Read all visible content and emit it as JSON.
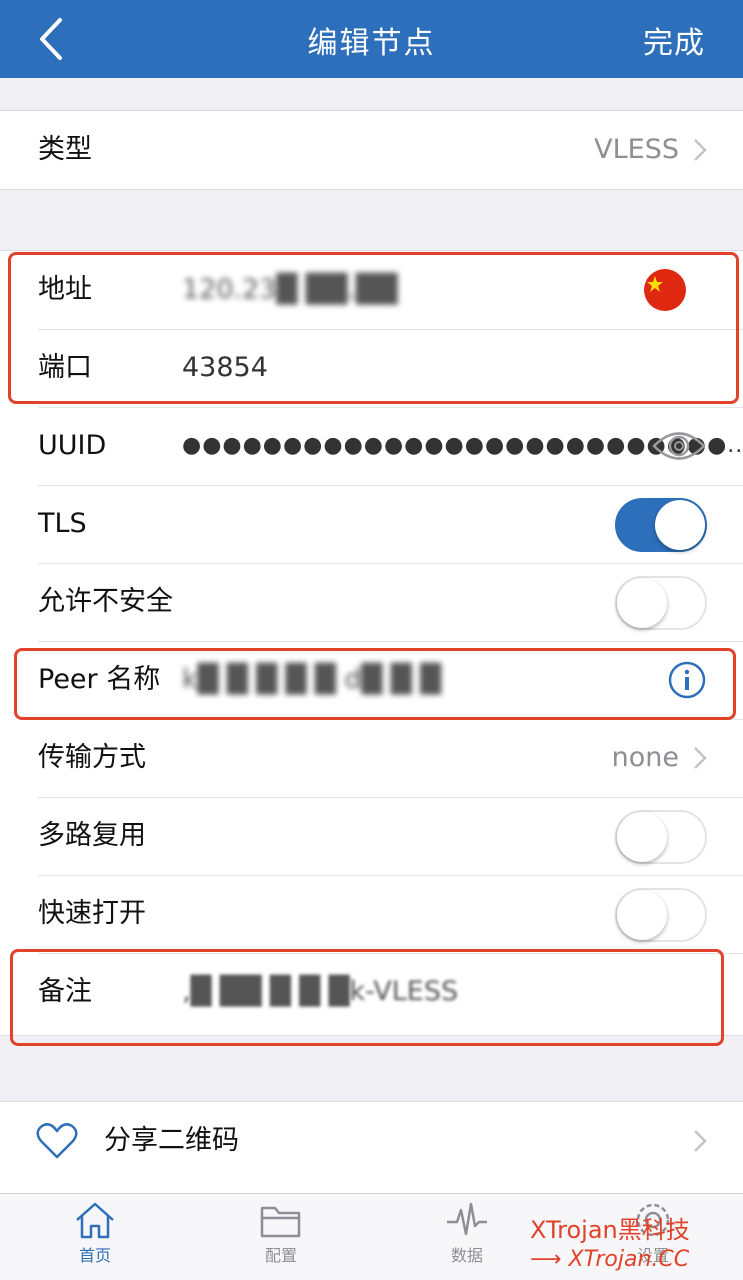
{
  "nav": {
    "title": "编辑节点",
    "done_label": "完成"
  },
  "type_row": {
    "label": "类型",
    "value": "VLESS"
  },
  "address_row": {
    "label": "地址",
    "value": "120.23█ ██.██"
  },
  "port_row": {
    "label": "端口",
    "value": "43854"
  },
  "uuid_row": {
    "label": "UUID",
    "value": "●●●●●●●●●●●●●●●●●●●●●●●●●●●..."
  },
  "tls_row": {
    "label": "TLS",
    "on": true
  },
  "insecure_row": {
    "label": "允许不安全",
    "on": false
  },
  "peer_row": {
    "label": "Peer 名称",
    "value": "k█ █ █ █ █ d█ █ █"
  },
  "transport_row": {
    "label": "传输方式",
    "value": "none"
  },
  "mux_row": {
    "label": "多路复用",
    "on": false
  },
  "fastopen_row": {
    "label": "快速打开",
    "on": false
  },
  "remark_row": {
    "label": "备注",
    "value": "‚█ ██ █ █ █k-VLESS"
  },
  "share_row": {
    "label": "分享二维码"
  },
  "tabs": [
    {
      "label": "首页",
      "icon": "home-icon",
      "active": true
    },
    {
      "label": "配置",
      "icon": "folder-icon",
      "active": false
    },
    {
      "label": "数据",
      "icon": "pulse-icon",
      "active": false
    },
    {
      "label": "设置",
      "icon": "gear-icon",
      "active": false
    }
  ],
  "watermark": {
    "line1": "XTrojan黑科技",
    "line2": "XTrojan.CC"
  },
  "colors": {
    "accent": "#2d6fba",
    "highlight": "#e0422a"
  }
}
